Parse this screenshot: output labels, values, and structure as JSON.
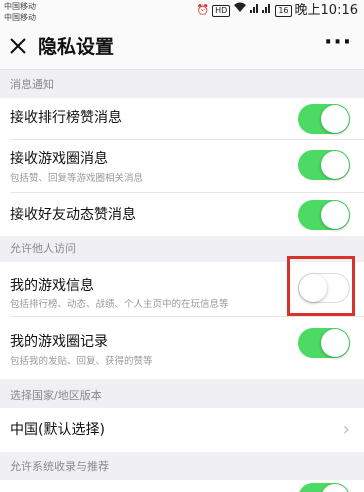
{
  "status_bar": {
    "carrier1": "中国移动",
    "carrier2": "中国移动",
    "icons": [
      "alarm-icon",
      "hd-icon",
      "wifi-icon",
      "signal-icon",
      "battery-icon"
    ],
    "battery": "16",
    "time": "晚上10:16"
  },
  "header": {
    "title": "隐私设置",
    "more": "···"
  },
  "sections": {
    "message_notice": "消息通知",
    "allow_visit": "允许他人访问",
    "region": "选择国家/地区版本",
    "system": "允许系统收录与推荐"
  },
  "rows": {
    "rank_like": {
      "title": "接收排行榜赞消息",
      "toggle": "on"
    },
    "game_circle": {
      "title": "接收游戏圈消息",
      "subtitle": "包括赞、回复等游戏圈相关消息",
      "toggle": "on"
    },
    "friend_like": {
      "title": "接收好友动态赞消息",
      "toggle": "on"
    },
    "my_game_info": {
      "title": "我的游戏信息",
      "subtitle": "包括排行榜、动态、战绩、个人主页中的在玩信息等",
      "toggle": "off"
    },
    "my_game_circle": {
      "title": "我的游戏圈记录",
      "subtitle": "包括我的发贴、回复、获得的赞等",
      "toggle": "on"
    },
    "region_choice": {
      "title": "中国(默认选择)"
    }
  },
  "colors": {
    "toggle_on": "#4cd964",
    "highlight": "#d9322e"
  }
}
